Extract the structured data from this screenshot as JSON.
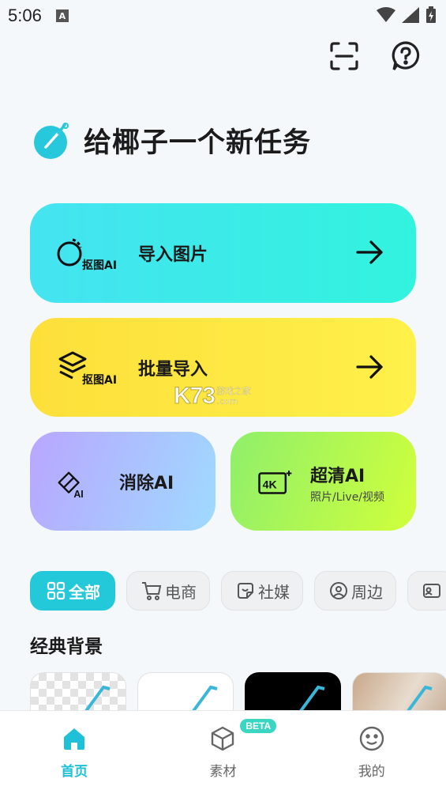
{
  "status_bar": {
    "time": "5:06",
    "notification_letter": "A"
  },
  "hero": {
    "title": "给椰子一个新任务"
  },
  "cards": {
    "import": {
      "label": "导入图片",
      "badge": "抠图AI"
    },
    "batch": {
      "label": "批量导入",
      "badge": "抠图AI"
    },
    "erase": {
      "label": "消除AI",
      "badge": "AI"
    },
    "hd": {
      "label": "超清AI",
      "sublabel": "照片/Live/视频",
      "badge": "4K"
    }
  },
  "watermark": {
    "big": "K73",
    "line1": "游戏之家",
    "line2": ".com"
  },
  "chips": [
    {
      "label": "全部",
      "icon": "grid-icon",
      "active": true
    },
    {
      "label": "电商",
      "icon": "cart-icon",
      "active": false
    },
    {
      "label": "社媒",
      "icon": "sticker-icon",
      "active": false
    },
    {
      "label": "周边",
      "icon": "face-tag-icon",
      "active": false
    },
    {
      "label": "",
      "icon": "id-card-icon",
      "active": false
    }
  ],
  "section": {
    "title": "经典背景"
  },
  "bottom_nav": {
    "home": "首页",
    "materials": "素材",
    "materials_badge": "BETA",
    "mine": "我的"
  },
  "colors": {
    "accent": "#24c9d9",
    "card_import": "#45e3f1",
    "card_batch": "#fddf3a",
    "card_erase": "#b9a6ff",
    "card_hd": "#8fef6b"
  }
}
